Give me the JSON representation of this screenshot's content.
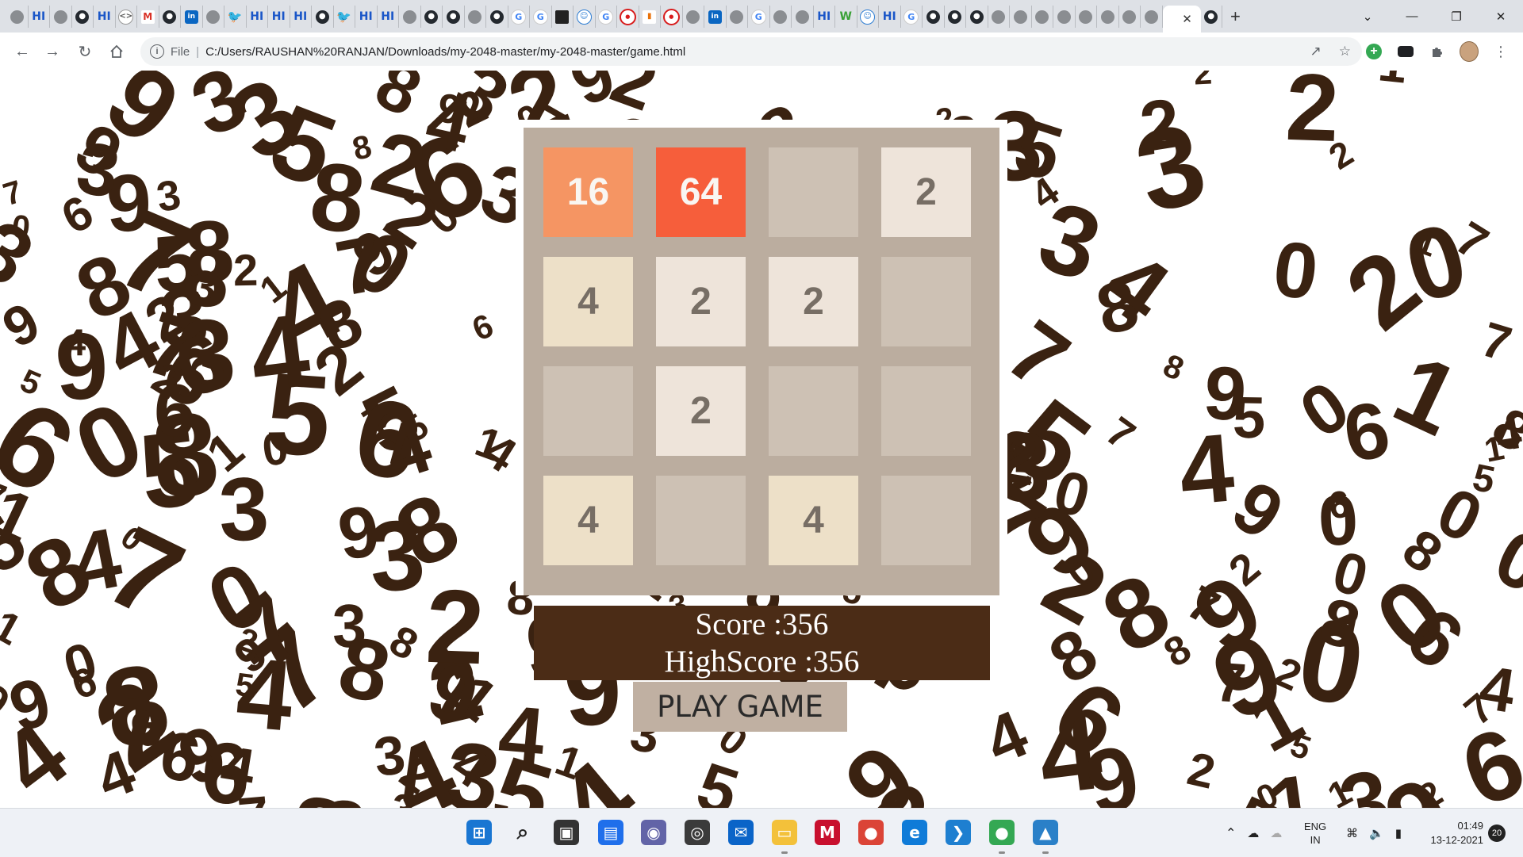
{
  "browser": {
    "tab_favicons": [
      "chrome-icon",
      "hi-icon",
      "chrome-icon",
      "github-icon",
      "hi-icon",
      "code-icon",
      "gmail-icon",
      "github-icon",
      "linkedin-icon",
      "chrome-icon",
      "twitter-icon",
      "hi-icon",
      "hi-icon",
      "hi-icon",
      "github-icon",
      "twitter-icon",
      "hi-icon",
      "hi-icon",
      "chrome-icon",
      "github-icon",
      "github-icon",
      "chrome-icon",
      "github-icon",
      "google-icon",
      "google-icon",
      "flag-icon",
      "smiley-icon",
      "google-icon",
      "red-icon",
      "chart-icon",
      "red-icon",
      "chrome-icon",
      "linkedin-icon",
      "chrome-icon",
      "google-icon",
      "chrome-icon",
      "chrome-icon",
      "hi-icon",
      "w-icon",
      "smiley-icon",
      "hi-icon",
      "google-icon",
      "github-icon",
      "github-icon",
      "github-icon",
      "grey-icon",
      "grey-icon",
      "grey-icon",
      "grey-icon",
      "grey-icon",
      "grey-icon",
      "grey-icon",
      "grey-icon"
    ],
    "active_tab_close": "✕",
    "new_tab": "+",
    "window_controls": {
      "chevron": "⌄",
      "minimize": "—",
      "restore": "❐",
      "close": "✕"
    },
    "address": {
      "info": "i",
      "scheme_label": "File",
      "separator": "|",
      "url": "C:/Users/RAUSHAN%20RANJAN/Downloads/my-2048-master/my-2048-master/game.html"
    }
  },
  "game": {
    "board": [
      [
        16,
        64,
        null,
        2
      ],
      [
        4,
        2,
        2,
        null
      ],
      [
        null,
        2,
        null,
        null
      ],
      [
        4,
        null,
        4,
        null
      ]
    ],
    "score_text": "Score :356",
    "highscore_text": "HighScore :356",
    "play_button": "PLAY GAME",
    "tile_colors": {
      "empty": "#cdc1b4",
      "2": "#eee4da",
      "4": "#ede0c8",
      "16": "#f59563",
      "64": "#f65e3b"
    }
  },
  "taskbar": {
    "apps": [
      "windows-start-icon",
      "search-icon",
      "task-view-icon",
      "widgets-icon",
      "teams-chat-icon",
      "app-icon",
      "mail-icon",
      "file-explorer-icon",
      "mcafee-icon",
      "chrome-icon",
      "edge-icon",
      "vscode-icon",
      "chrome-profile-icon",
      "photos-icon"
    ],
    "language_line1": "ENG",
    "language_line2": "IN",
    "time": "01:49",
    "date": "13-12-2021",
    "notification_count": "20"
  }
}
